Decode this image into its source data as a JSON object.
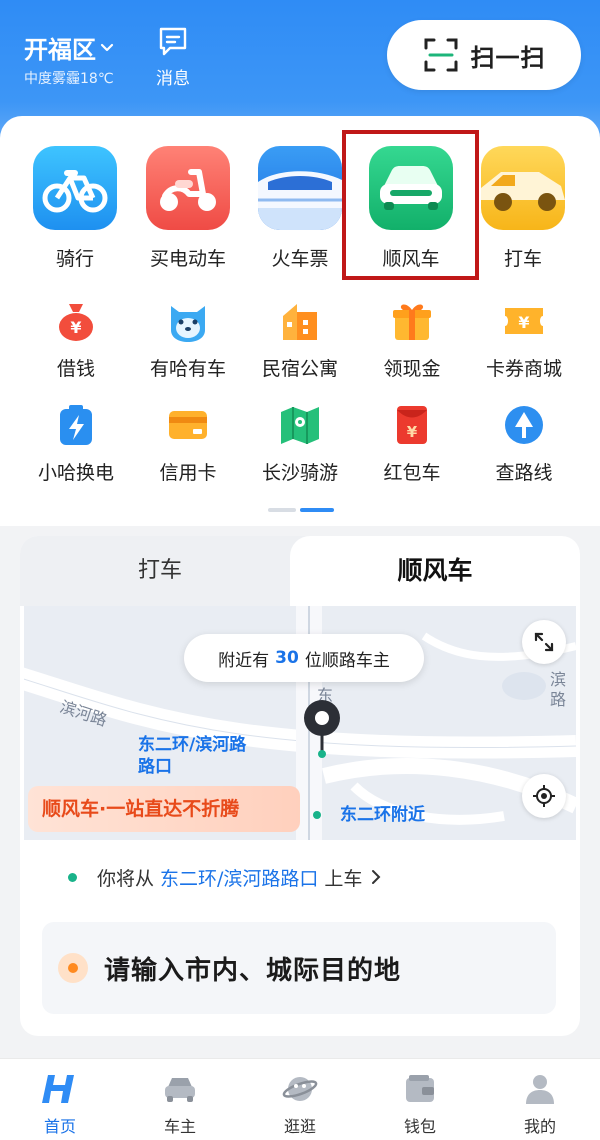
{
  "header": {
    "city": "开福区",
    "weather": "中度雾霾18℃",
    "message_label": "消息",
    "scan_label": "扫一扫"
  },
  "big_services": [
    {
      "label": "骑行",
      "icon": "bicycle-icon"
    },
    {
      "label": "买电动车",
      "icon": "scooter-icon"
    },
    {
      "label": "火车票",
      "icon": "train-icon"
    },
    {
      "label": "顺风车",
      "icon": "carpool-car-icon"
    },
    {
      "label": "打车",
      "icon": "taxi-icon"
    }
  ],
  "small_services_row1": [
    {
      "label": "借钱",
      "icon": "money-bag-icon"
    },
    {
      "label": "有哈有车",
      "icon": "dog-face-icon"
    },
    {
      "label": "民宿公寓",
      "icon": "building-icon"
    },
    {
      "label": "领现金",
      "icon": "gift-icon"
    },
    {
      "label": "卡券商城",
      "icon": "coupon-icon"
    }
  ],
  "small_services_row2": [
    {
      "label": "小哈换电",
      "icon": "battery-icon"
    },
    {
      "label": "信用卡",
      "icon": "credit-card-icon"
    },
    {
      "label": "长沙骑游",
      "icon": "map-icon"
    },
    {
      "label": "红包车",
      "icon": "red-packet-icon"
    },
    {
      "label": "查路线",
      "icon": "route-icon"
    }
  ],
  "ride": {
    "tab_taxi": "打车",
    "tab_carpool": "顺风车",
    "nearby_prefix": "附近有",
    "nearby_count": "30",
    "nearby_suffix": "位顺路车主",
    "road_binhe": "滨河路",
    "road_dong": "东",
    "road_bin": "滨",
    "road_lu": "路",
    "pin_label_line1": "东二环/滨河路",
    "pin_label_line2": "路口",
    "near_label": "东二环附近",
    "promo": "顺风车·一站直达不折腾",
    "pickup_prefix": "你将从",
    "pickup_location": "东二环/滨河路路口",
    "pickup_suffix": "上车",
    "destination_placeholder": "请输入市内、城际目的地"
  },
  "bottom_nav": [
    {
      "label": "首页",
      "icon": "home-h-icon",
      "active": true
    },
    {
      "label": "车主",
      "icon": "car-owner-icon",
      "active": false
    },
    {
      "label": "逛逛",
      "icon": "planet-icon",
      "active": false
    },
    {
      "label": "钱包",
      "icon": "wallet-icon",
      "active": false
    },
    {
      "label": "我的",
      "icon": "profile-icon",
      "active": false
    }
  ],
  "colors": {
    "brand_blue": "#2f8cf5",
    "highlight_red": "#c01818",
    "link_blue": "#1a73e8",
    "promo_orange": "#e84a1a"
  }
}
